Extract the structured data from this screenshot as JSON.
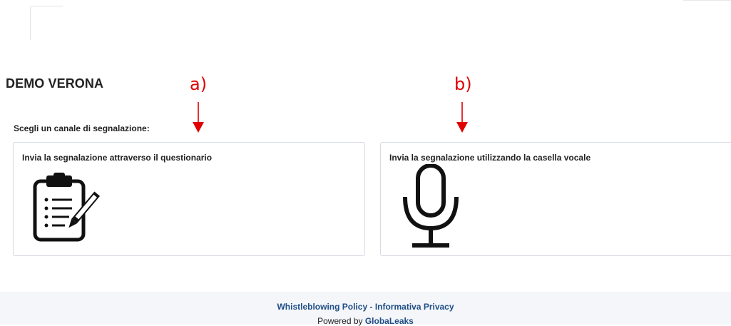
{
  "header": {
    "site_title": "DEMO VERONA"
  },
  "annotations": {
    "a_label": "a)",
    "b_label": "b)",
    "color": "#e00000"
  },
  "main": {
    "choose_label": "Scegli un canale di segnalazione:",
    "channels": [
      {
        "title": "Invia la segnalazione attraverso il questionario",
        "icon": "clipboard-icon"
      },
      {
        "title": "Invia la segnalazione utilizzando la casella vocale",
        "icon": "microphone-icon"
      }
    ]
  },
  "footer": {
    "policy_link": "Whistleblowing Policy",
    "separator": " - ",
    "privacy_link": "Informativa Privacy",
    "powered_prefix": "Powered by ",
    "powered_link": "GlobaLeaks",
    "link_color": "#1f4e86",
    "background": "#f4f6f9"
  }
}
